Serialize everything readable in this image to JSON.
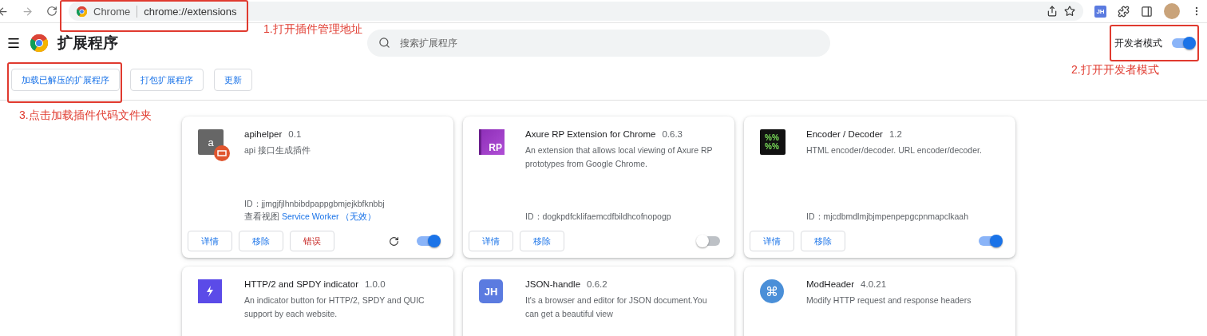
{
  "browser": {
    "site_label": "Chrome",
    "url": "chrome://extensions",
    "profile_badge": "JH"
  },
  "header": {
    "title": "扩展程序",
    "search": {
      "placeholder": "搜索扩展程序"
    },
    "dev_mode": {
      "label": "开发者模式",
      "on": true
    }
  },
  "actions": [
    "加载已解压的扩展程序",
    "打包扩展程序",
    "更新"
  ],
  "extensions": [
    {
      "name": "apihelper",
      "version": "0.1",
      "description": "api 接口生成插件",
      "icon": {
        "kind": "letter",
        "text": "a"
      },
      "id_label": "ID：",
      "id": "jjmgjfjlhnbibdpappgbmjejkbfknbbj",
      "inspect": {
        "label": "查看视图",
        "link": "Service Worker",
        "note": "（无效）"
      },
      "buttons": [
        {
          "label": "详情",
          "kind": "normal"
        },
        {
          "label": "移除",
          "kind": "normal"
        },
        {
          "label": "错误",
          "kind": "error"
        }
      ],
      "reload": true,
      "enabled": true
    },
    {
      "name": "Axure RP Extension for Chrome",
      "version": "0.6.3",
      "description": "An extension that allows local viewing of Axure RP prototypes from Google Chrome.",
      "icon": {
        "kind": "rp",
        "text": "RP"
      },
      "id_label": "ID：",
      "id": "dogkpdfcklifaemcdfbildhcofnopogp",
      "buttons": [
        {
          "label": "详情",
          "kind": "normal"
        },
        {
          "label": "移除",
          "kind": "normal"
        }
      ],
      "reload": false,
      "enabled": false
    },
    {
      "name": "Encoder / Decoder",
      "version": "1.2",
      "description": "HTML encoder/decoder. URL encoder/decoder.",
      "icon": {
        "kind": "percent",
        "text": "%%%%"
      },
      "id_label": "ID：",
      "id": "mjcdbmdlmjbjmpenpepgcpnmapclkaah",
      "buttons": [
        {
          "label": "详情",
          "kind": "normal"
        },
        {
          "label": "移除",
          "kind": "normal"
        }
      ],
      "reload": false,
      "enabled": true
    },
    {
      "name": "HTTP/2 and SPDY indicator",
      "version": "1.0.0",
      "description": "An indicator button for HTTP/2, SPDY and QUIC support by each website.",
      "icon": {
        "kind": "bolt"
      }
    },
    {
      "name": "JSON-handle",
      "version": "0.6.2",
      "description": "It's a browser and editor for JSON document.You can get a beautiful view",
      "icon": {
        "kind": "jh",
        "text": "JH"
      }
    },
    {
      "name": "ModHeader",
      "version": "4.0.21",
      "description": "Modify HTTP request and response headers",
      "icon": {
        "kind": "cmd",
        "text": "⌘"
      }
    }
  ],
  "annotations": [
    "1.打开插件管理地址",
    "2.打开开发者模式",
    "3.点击加载插件代码文件夹"
  ]
}
